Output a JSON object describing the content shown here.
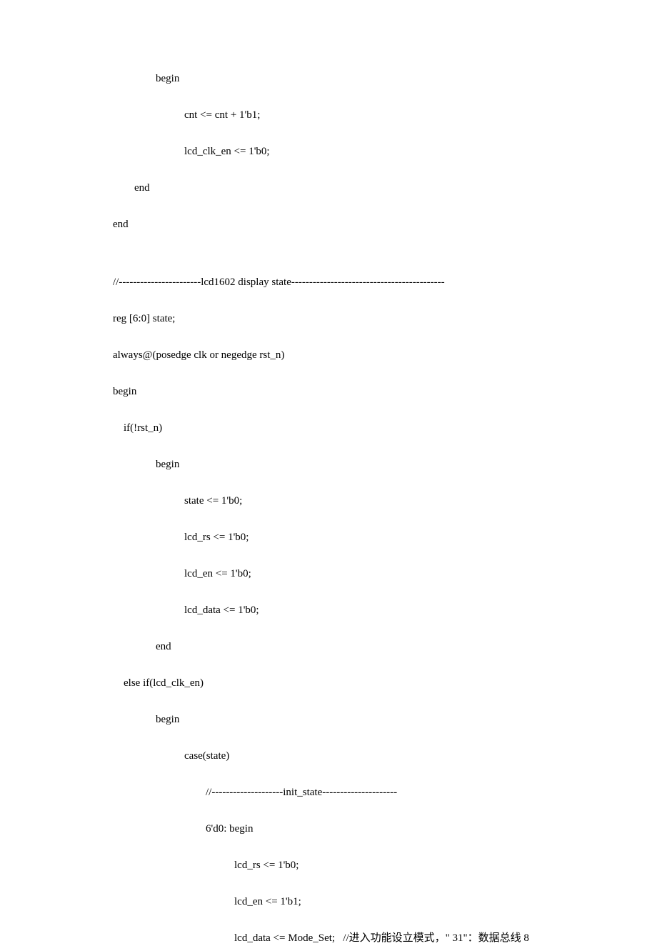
{
  "code": {
    "l01": "begin",
    "l02": "cnt <= cnt + 1'b1;",
    "l03": "lcd_clk_en <= 1'b0;",
    "l04": "end",
    "l05": "end",
    "l06": "",
    "l07": "//-----------------------lcd1602 display state-------------------------------------------",
    "l08": "reg [6:0] state;",
    "l09": "always@(posedge clk or negedge rst_n)",
    "l10": "begin",
    "l11": "    if(!rst_n)",
    "l12": "begin",
    "l13": "state <= 1'b0;",
    "l14": "lcd_rs <= 1'b0;",
    "l15": "lcd_en <= 1'b0;",
    "l16": "lcd_data <= 1'b0;",
    "l17": "end",
    "l18": "    else if(lcd_clk_en)",
    "l19": "begin",
    "l20": "case(state)",
    "l21": "//--------------------init_state---------------------",
    "l22": "6'd0: begin",
    "l23": "lcd_rs <= 1'b0;",
    "l24": "lcd_en <= 1'b1;",
    "l25": "lcd_data <= Mode_Set;   //进入功能设立模式，\" 31\"：数据总线 8"
  }
}
